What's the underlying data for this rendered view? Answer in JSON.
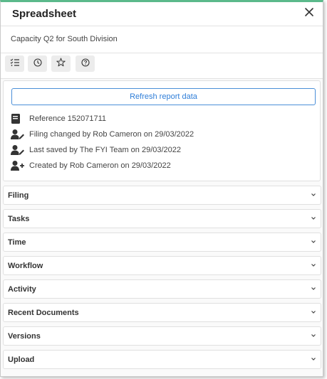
{
  "panel": {
    "title": "Spreadsheet",
    "subtitle": "Capacity Q2 for South Division",
    "accent_color": "#5bb98b"
  },
  "toolbar": {
    "buttons": [
      {
        "icon": "list-icon"
      },
      {
        "icon": "clock-icon"
      },
      {
        "icon": "star-icon"
      },
      {
        "icon": "help-icon"
      }
    ]
  },
  "info": {
    "refresh_label": "Refresh report data",
    "reference": "Reference 152071711",
    "filing_changed": "Filing changed by Rob Cameron on 29/03/2022",
    "last_saved": "Last saved by The FYI Team on 29/03/2022",
    "created": "Created by Rob Cameron on 29/03/2022"
  },
  "sections": [
    {
      "label": "Filing"
    },
    {
      "label": "Tasks"
    },
    {
      "label": "Time"
    },
    {
      "label": "Workflow"
    },
    {
      "label": "Activity"
    },
    {
      "label": "Recent Documents"
    },
    {
      "label": "Versions"
    },
    {
      "label": "Upload"
    }
  ]
}
